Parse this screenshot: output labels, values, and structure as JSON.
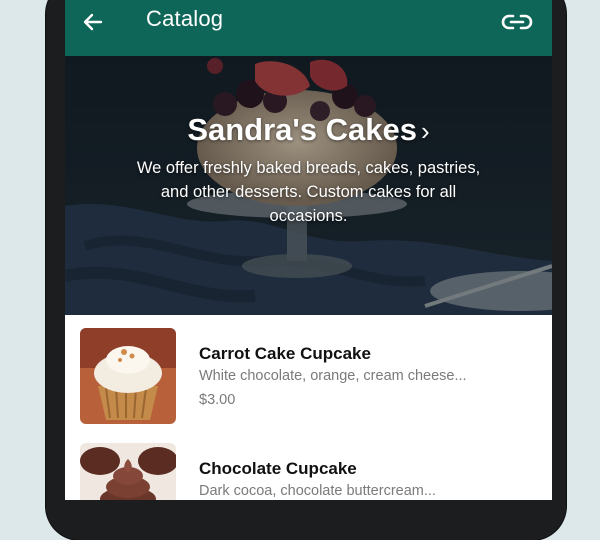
{
  "header": {
    "title": "Catalog",
    "back_icon": "arrow-left-icon",
    "link_icon": "link-icon",
    "color": "#0e6658"
  },
  "hero": {
    "shop_name": "Sandra's Cakes",
    "chevron": "›",
    "description": "We offer freshly baked breads, cakes, pastries, and other desserts. Custom cakes for all occasions."
  },
  "products": [
    {
      "name": "Carrot Cake Cupcake",
      "description": "White chocolate, orange, cream cheese...",
      "price": "$3.00"
    },
    {
      "name": "Chocolate Cupcake",
      "description": "Dark cocoa, chocolate buttercream...",
      "price": ""
    }
  ]
}
